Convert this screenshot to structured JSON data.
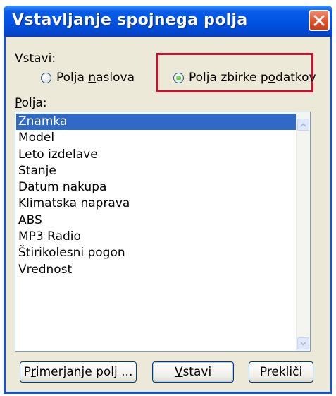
{
  "dialog": {
    "title": "Vstavljanje spojnega polja"
  },
  "insert_label": "Vstavi:",
  "radio_options": [
    {
      "label_before": "Polja ",
      "label_mnemonic": "n",
      "label_after": "aslova",
      "selected": false
    },
    {
      "label_before": "Polja zbirke p",
      "label_mnemonic": "o",
      "label_after": "datkov",
      "selected": true
    }
  ],
  "fields_label": {
    "mnemonic": "P",
    "rest": "olja:"
  },
  "fields": [
    "Znamka",
    "Model",
    "Leto izdelave",
    "Stanje",
    "Datum nakupa",
    "Klimatska naprava",
    "ABS",
    "MP3 Radio",
    "Štirikolesni pogon",
    "Vrednost"
  ],
  "selected_field": "Znamka",
  "buttons": {
    "match": {
      "before": "P",
      "mnemonic": "r",
      "after": "imerjanje polj ..."
    },
    "insert": {
      "before": "",
      "mnemonic": "V",
      "after": "stavi"
    },
    "cancel": {
      "label": "Prekliči"
    }
  },
  "colors": {
    "title_bar": "#0054e3",
    "selection": "#316ac5",
    "highlight_border": "#c8102e",
    "close_button": "#e0502a"
  }
}
